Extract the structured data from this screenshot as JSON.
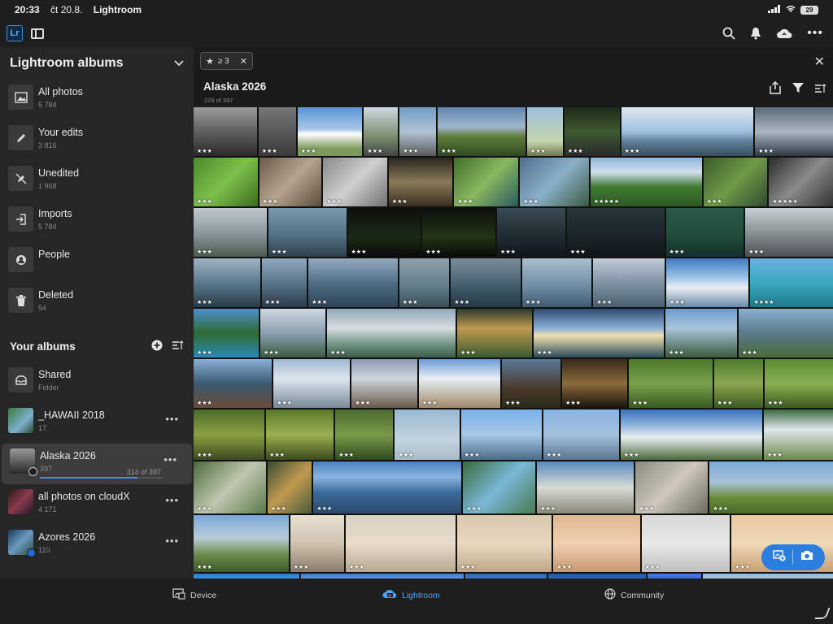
{
  "status": {
    "time": "20:33",
    "date": "čt 20.8.",
    "app": "Lightroom",
    "battery": "29"
  },
  "sidebar": {
    "lightroom_albums_title": "Lightroom albums",
    "items": [
      {
        "label": "All photos",
        "count": "5 784",
        "icon": "photos-icon"
      },
      {
        "label": "Your edits",
        "count": "3 816",
        "icon": "pencil-icon"
      },
      {
        "label": "Unedited",
        "count": "1 968",
        "icon": "unedited-icon"
      },
      {
        "label": "Imports",
        "count": "5 784",
        "icon": "import-icon"
      },
      {
        "label": "People",
        "count": "",
        "icon": "people-icon"
      },
      {
        "label": "Deleted",
        "count": "54",
        "icon": "trash-icon"
      }
    ],
    "your_albums_title": "Your albums",
    "albums": [
      {
        "label": "Shared",
        "count": "Folder"
      },
      {
        "label": "_HAWAII 2018",
        "count": "17"
      },
      {
        "label": "Alaska 2026",
        "count": "397",
        "sync": "314 of 397",
        "progress": 0.79
      },
      {
        "label": "all photos on cloudX",
        "count": "4 171"
      },
      {
        "label": "Azores 2026",
        "count": "110"
      }
    ]
  },
  "filter": {
    "chip_label": "≥ 3"
  },
  "album": {
    "title": "Alaska 2026",
    "subtitle": "229 of 397"
  },
  "tabs": {
    "device": "Device",
    "lightroom": "Lightroom",
    "community": "Community"
  },
  "colors": {
    "accent": "#2b7de0",
    "selected_tab": "#4aa3ff"
  },
  "photos": {
    "rows": [
      [
        {
          "w": 78,
          "c": "linear-gradient(#9a9a9a,#555 60%,#2a2a2a)",
          "s": "★★★"
        },
        {
          "w": 46,
          "c": "linear-gradient(#777,#3b3b3b)",
          "s": "★★★"
        },
        {
          "w": 80,
          "c": "linear-gradient(#5b94d6 0%,#a7c7e8 45%,#ffffff 55%,#7a9a5a 85%)",
          "s": "★★★"
        },
        {
          "w": 42,
          "c": "linear-gradient(#cfd8e0,#7a8f70 60%,#444)",
          "s": "★★★"
        },
        {
          "w": 45,
          "c": "linear-gradient(#6f9cc8,#b0c4d2 50%,#5a5a5a)",
          "s": "★★★"
        },
        {
          "w": 108,
          "c": "linear-gradient(#5f86b0 0%,#9fb7cc 40%,#5f7d3a 60%,#2f4a20)",
          "s": "★★★"
        },
        {
          "w": 44,
          "c": "linear-gradient(#9cc0dd,#c6d6b0 70%,#6b7a4a)",
          "s": "★★★"
        },
        {
          "w": 68,
          "c": "linear-gradient(#1f2a1a,#3c5a30 50%,#2a2a2a)",
          "s": "★★★"
        },
        {
          "w": 163,
          "c": "linear-gradient(#dfe9f2 0%,#9fc0e0 50%,#5d7f98 70%,#3a4f5e)",
          "s": "★★★"
        },
        {
          "w": 96,
          "c": "linear-gradient(#5a6a78,#a9b6c0 50%,#2c3a44)",
          "s": "★★★"
        }
      ],
      [
        {
          "w": 78,
          "c": "linear-gradient(135deg,#4a8a2a,#7cc04a 50%,#3d6b20)",
          "s": "★★★"
        },
        {
          "w": 76,
          "c": "linear-gradient(135deg,#6b5a4a,#b5a58f 50%,#5a4a3a)",
          "s": "★★★"
        },
        {
          "w": 78,
          "c": "linear-gradient(135deg,#8a8a8a,#cfcfcf 50%,#6f6f6f)",
          "s": "★★★"
        },
        {
          "w": 78,
          "c": "linear-gradient(#2a241e,#8a7a5a 50%,#3a2e22)",
          "s": "★★★"
        },
        {
          "w": 78,
          "c": "linear-gradient(135deg,#3f6e2a,#8ab860 50%,#2a5a60)",
          "s": "★★★"
        },
        {
          "w": 84,
          "c": "linear-gradient(135deg,#4f7090,#8ab0c8 50%,#3a5a40)",
          "s": "★★★"
        },
        {
          "w": 136,
          "c": "linear-gradient(#8fb4d8 0%,#cfe0ee 30%,#3f7a30 60%,#2f5a24)",
          "s": "★★★★★"
        },
        {
          "w": 78,
          "c": "linear-gradient(135deg,#3a5a2a,#6f9a48 50%,#2f4a30)",
          "s": "★★★"
        },
        {
          "w": 78,
          "c": "linear-gradient(135deg,#2a2a2a,#8a8a8a 50%,#333)",
          "s": "★★★★★"
        }
      ],
      [
        {
          "w": 90,
          "c": "linear-gradient(#c0c8ce,#8a9aa0 50%,#4a5a4e)",
          "s": "★★★"
        },
        {
          "w": 96,
          "c": "linear-gradient(#7a9aae,#4f6e80 60%,#2f3e48)",
          "s": "★★★"
        },
        {
          "w": 90,
          "c": "linear-gradient(#0e0e0e,#1a2a14 60%,#0a0a0a)",
          "s": "★★★"
        },
        {
          "w": 90,
          "c": "linear-gradient(#0f0f0f,#213414 60%,#0a0a0a)",
          "s": "★★★"
        },
        {
          "w": 84,
          "c": "linear-gradient(#3a4a52,#1f2a30 60%,#10161a)",
          "s": "★★★"
        },
        {
          "w": 120,
          "c": "linear-gradient(#29353a,#1a2428 60%,#0f1518)",
          "s": "★★★"
        },
        {
          "w": 96,
          "c": "linear-gradient(#2a5a4a,#1f4a3a 60%,#153028)",
          "s": "★★★"
        },
        {
          "w": 108,
          "c": "linear-gradient(#c8cfd4,#8a9296 50%,#4a4f52)",
          "s": "★★★"
        }
      ],
      [
        {
          "w": 82,
          "c": "linear-gradient(#9fb4c4,#4f6e80 60%,#2a3a44)",
          "s": "★★★"
        },
        {
          "w": 56,
          "c": "linear-gradient(#8fa8c0,#4f6a7e 60%,#2a3a48)",
          "s": "★★★"
        },
        {
          "w": 110,
          "c": "linear-gradient(#93aac0,#4f6e86 50%,#2e4454)",
          "s": "★★★"
        },
        {
          "w": 62,
          "c": "linear-gradient(#8fa2ae,#5f7a88 60%,#3a4e58)",
          "s": "★★★"
        },
        {
          "w": 86,
          "c": "linear-gradient(#7a8e9a,#3f5a6a 60%,#263844)",
          "s": "★★★"
        },
        {
          "w": 86,
          "c": "linear-gradient(#a9bfd0,#6d8aa0 60%,#3f5a70)",
          "s": "★★★"
        },
        {
          "w": 88,
          "c": "linear-gradient(#c0ccd8,#7e94a6 50%,#4a6070)",
          "s": "★★★"
        },
        {
          "w": 102,
          "c": "linear-gradient(#3a7ac0,#9fc4e8 40%,#e8eef2 60%,#6a8aa8)",
          "s": "★★★"
        },
        {
          "w": 102,
          "c": "linear-gradient(#6ab0e0,#3aa8c0 50%,#1f7a8a)",
          "s": "★★★★"
        }
      ],
      [
        {
          "w": 80,
          "c": "linear-gradient(#4a90d0,#2f6a30 50%,#2a8ab8)",
          "s": "★★★"
        },
        {
          "w": 80,
          "c": "linear-gradient(#cfd8e0,#8aa0b0 50%,#3a5a40)",
          "s": "★★★"
        },
        {
          "w": 158,
          "c": "linear-gradient(#8fa8b8,#d8dde2 40%,#7a9a8a 70%,#3a5a4a)",
          "s": "★★★"
        },
        {
          "w": 92,
          "c": "linear-gradient(#2a3a2a,#c09a50 40%,#3a5a30)",
          "s": "★★★"
        },
        {
          "w": 160,
          "c": "linear-gradient(#2f4a70,#8ab0d8 40%,#f0e0b0 55%,#2a4a5a)",
          "s": "★★★"
        },
        {
          "w": 88,
          "c": "linear-gradient(#6a9ad0,#a8c4dc 40%,#3a5a3a)",
          "s": "★★★"
        },
        {
          "w": 116,
          "c": "linear-gradient(#8ab0d0,#5a7a8a 50%,#4a6a3a)",
          "s": "★★★"
        }
      ],
      [
        {
          "w": 96,
          "c": "linear-gradient(#8ab0d8,#3a5a70 50%,#6a4a3a)",
          "s": "★★★"
        },
        {
          "w": 94,
          "c": "linear-gradient(#9fb8d0,#dce6ee 40%,#7a8a9a)",
          "s": "★★★"
        },
        {
          "w": 80,
          "c": "linear-gradient(#8a9ab0,#cfd6dc 40%,#6a5a4a)",
          "s": "★★★"
        },
        {
          "w": 100,
          "c": "linear-gradient(#6a9ad8,#e8eef4 40%,#a08a6a)",
          "s": "★★★"
        },
        {
          "w": 72,
          "c": "linear-gradient(#5a7a9a,#4a3a2a 60%,#2a2a1a)",
          "s": "★★★"
        },
        {
          "w": 80,
          "c": "linear-gradient(#3a2a1a,#8a6a3a 50%,#1a140e)",
          "s": "★★★"
        },
        {
          "w": 102,
          "c": "linear-gradient(#4a7a2a,#7aa04a 50%,#3a5a20)",
          "s": "★★★"
        },
        {
          "w": 60,
          "c": "linear-gradient(#4a7a2a,#8aa850 50%,#3a5a20)",
          "s": "★★★"
        },
        {
          "w": 84,
          "c": "linear-gradient(#5a8a30,#8ab050 50%,#3a5a20)",
          "s": "★★★"
        }
      ],
      [
        {
          "w": 88,
          "c": "linear-gradient(#4a6a2a,#8aa040 50%,#3a4a20)",
          "s": "★★★"
        },
        {
          "w": 84,
          "c": "linear-gradient(#5a7a2a,#9ab050 50%,#3a4a1a)",
          "s": "★★★"
        },
        {
          "w": 72,
          "c": "linear-gradient(#4a6a30,#7a9a4a 50%,#2f4a20)",
          "s": "★★★"
        },
        {
          "w": 80,
          "c": "linear-gradient(#9ab8d0,#c4d4e0 60%,#a8bac8)",
          "s": "★★★"
        },
        {
          "w": 100,
          "c": "linear-gradient(#7ab0e8,#a8c8e8 50%,#4a6a8a)",
          "s": "★★★"
        },
        {
          "w": 94,
          "c": "linear-gradient(#8ab4e0,#a4c0dc 50%,#5a7490)",
          "s": "★★★"
        },
        {
          "w": 176,
          "c": "linear-gradient(#3a70c0,#8ab0d8 30%,#e8eef0 55%,#4a6a3a)",
          "s": "★★★"
        },
        {
          "w": 86,
          "c": "linear-gradient(#3a6a40,#e0e8ec 40%,#6a8a4a)",
          "s": "★★★"
        }
      ],
      [
        {
          "w": 88,
          "c": "linear-gradient(135deg,#4a6a3a,#c0c8b0 50%,#5a7a4a)",
          "s": "★★★"
        },
        {
          "w": 54,
          "c": "linear-gradient(135deg,#3a4a30,#c09a50 50%,#4a5a3a)",
          "s": "★★★"
        },
        {
          "w": 180,
          "c": "linear-gradient(#4a80c0,#8ab4e0 30%,#3a6a9a 60%,#2a4a6a)",
          "s": "★★★"
        },
        {
          "w": 88,
          "c": "linear-gradient(135deg,#3a6a3a,#7ab8d8 50%,#4a7a50)",
          "s": "★★★"
        },
        {
          "w": 118,
          "c": "linear-gradient(#5a8ac0,#d8dcd4 50%,#8a8a7a)",
          "s": "★★★"
        },
        {
          "w": 88,
          "c": "linear-gradient(135deg,#8a8a80,#cfc8bc 50%,#6a6a60)",
          "s": "★★★"
        },
        {
          "w": 150,
          "c": "linear-gradient(#7aaad8,#a8c4d8 40%,#6a8a3a 70%,#4a6a2a)",
          "s": "★★★"
        }
      ],
      [
        {
          "w": 116,
          "c": "linear-gradient(#7aa8d8,#b8ccd8 40%,#6a8a4a 70%,#3a5a2a)",
          "s": "★★★"
        },
        {
          "w": 66,
          "c": "linear-gradient(#e8e0d0,#d0c4b0 50%,#8a7a6a)",
          "s": "★★★"
        },
        {
          "w": 134,
          "c": "linear-gradient(#d8d0c4,#e8dccb 50%,#b8a890)",
          "s": "★★★"
        },
        {
          "w": 116,
          "c": "linear-gradient(#d8c8b0,#e8d8c0 50%,#c0a888)",
          "s": "★★★"
        },
        {
          "w": 106,
          "c": "linear-gradient(#e0b890,#f0d0b0 50%,#c89870)",
          "s": "★★★"
        },
        {
          "w": 108,
          "c": "linear-gradient(#d8d8d8,#e8e8e8 50%,#c0c0c0)",
          "s": "★★★"
        },
        {
          "w": 124,
          "c": "linear-gradient(#e8c8a0,#f0d8b8 50%,#c8a070)",
          "s": "★★★"
        }
      ],
      [
        {
          "w": 130,
          "c": "linear-gradient(#2a7ac8,#5aa0e0)",
          "s": ""
        },
        {
          "w": 200,
          "c": "linear-gradient(#3a80c8,#7ab0e0)",
          "s": ""
        },
        {
          "w": 100,
          "c": "linear-gradient(#2a6ab0,#4a8ad0)",
          "s": ""
        },
        {
          "w": 120,
          "c": "linear-gradient(#1a5aa0,#3a7ac0)",
          "s": ""
        },
        {
          "w": 66,
          "c": "linear-gradient(#4a7ae0,#2a5ac0)",
          "s": ""
        },
        {
          "w": 160,
          "c": "linear-gradient(#8ab8e0,#c8dcec)",
          "s": ""
        }
      ]
    ]
  }
}
